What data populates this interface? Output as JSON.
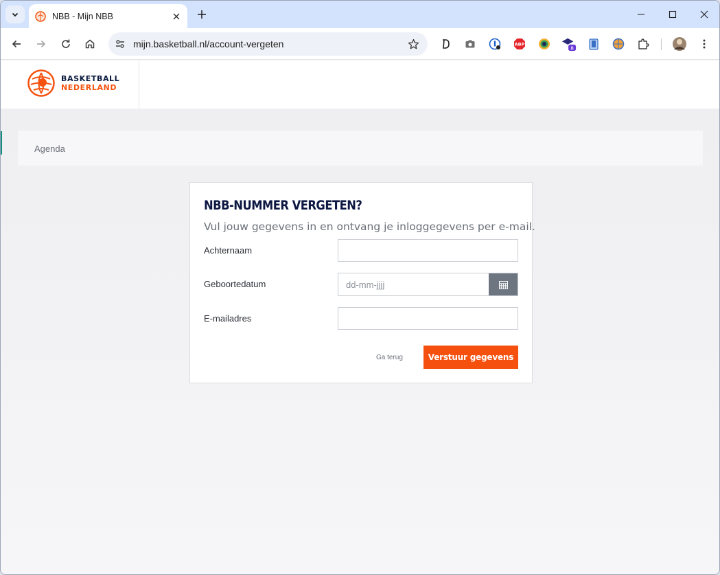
{
  "browser": {
    "tab_title": "NBB - Mijn NBB",
    "url": "mijn.basketball.nl/account-vergeten",
    "extensions": [
      "d-icon",
      "camera-icon",
      "password-manager-icon",
      "adblock-icon",
      "color-picker-icon",
      "graduation-cap-icon",
      "clipboard-icon",
      "wiki-icon",
      "puzzle-icon"
    ],
    "extension_badge": "8",
    "adblock_label": "ABP"
  },
  "header": {
    "logo_line1": "BASKETBALL",
    "logo_line2": "NEDERLAND"
  },
  "breadcrumb": {
    "label": "Agenda"
  },
  "form": {
    "heading": "NBB-NUMMER VERGETEN?",
    "subheading": "Vul jouw gegevens in en ontvang je inloggegevens per e-mail.",
    "lastname_label": "Achternaam",
    "lastname_value": "",
    "birthdate_label": "Geboortedatum",
    "birthdate_placeholder": "dd-mm-jjjj",
    "email_label": "E-mailadres",
    "email_value": "",
    "back_label": "Ga terug",
    "submit_label": "Verstuur gegevens"
  },
  "colors": {
    "accent": "#f5500e",
    "navy": "#0c1742",
    "tabstrip": "#d3e3fd"
  }
}
